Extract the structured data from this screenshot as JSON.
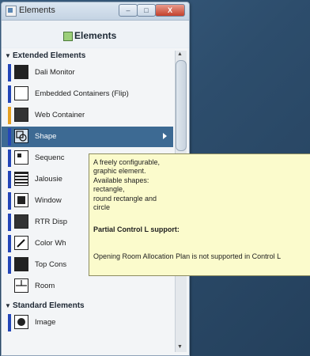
{
  "window": {
    "title": "Elements",
    "controls": {
      "minimize": "–",
      "maximize": "□",
      "close": "X"
    }
  },
  "panel": {
    "title": "Elements"
  },
  "sections": [
    {
      "title": "Extended Elements",
      "items": [
        {
          "label": "Dali Monitor",
          "icon": "dali-monitor-icon",
          "accent": "#2346b8"
        },
        {
          "label": "Embedded Containers (Flip)",
          "icon": "page-icon",
          "accent": "#2346b8"
        },
        {
          "label": "Web Container",
          "icon": "web-container-icon",
          "accent": "#e5a021"
        },
        {
          "label": "Shape",
          "icon": "shape-icon",
          "accent": "#2346b8",
          "selected": true
        },
        {
          "label": "Sequenc",
          "icon": "sequence-icon",
          "accent": "#2346b8"
        },
        {
          "label": "Jalousie",
          "icon": "jalousie-icon",
          "accent": "#2346b8"
        },
        {
          "label": "Window",
          "icon": "window-icon",
          "accent": "#2346b8"
        },
        {
          "label": "RTR Disp",
          "icon": "rtr-display-icon",
          "accent": "#2346b8"
        },
        {
          "label": "Color Wh",
          "icon": "color-picker-icon",
          "accent": "#2346b8"
        },
        {
          "label": "Top Cons",
          "icon": "top-consumers-icon",
          "accent": "#2346b8"
        },
        {
          "label": "Room",
          "icon": "room-icon",
          "accent": ""
        }
      ]
    },
    {
      "title": "Standard Elements",
      "items": [
        {
          "label": "Image",
          "icon": "image-icon",
          "accent": "#2346b8"
        }
      ]
    }
  ],
  "tooltip": {
    "lines": [
      "A freely configurable,",
      "graphic element.",
      "Available shapes:",
      "rectangle,",
      "round rectangle and",
      "circle"
    ],
    "heading": "Partial Control L support:",
    "note": "Opening Room Allocation Plan is not supported in Control L"
  }
}
